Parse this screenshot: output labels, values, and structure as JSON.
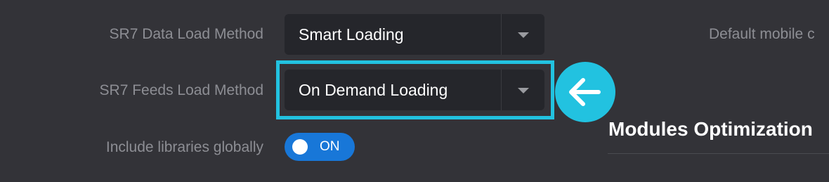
{
  "settings": {
    "data_load": {
      "label": "SR7 Data Load Method",
      "value": "Smart Loading"
    },
    "feeds_load": {
      "label": "SR7 Feeds Load Method",
      "value": "On Demand Loading"
    },
    "libraries": {
      "label": "Include libraries globally",
      "state": "ON"
    }
  },
  "right_panel": {
    "label": "Default mobile c",
    "section_title": "Modules Optimization"
  },
  "colors": {
    "background": "#333338",
    "highlight": "#22c2e0",
    "toggle_on": "#1877d8"
  },
  "icons": {
    "callout": "arrow-left-icon",
    "dropdown": "chevron-down-icon"
  }
}
